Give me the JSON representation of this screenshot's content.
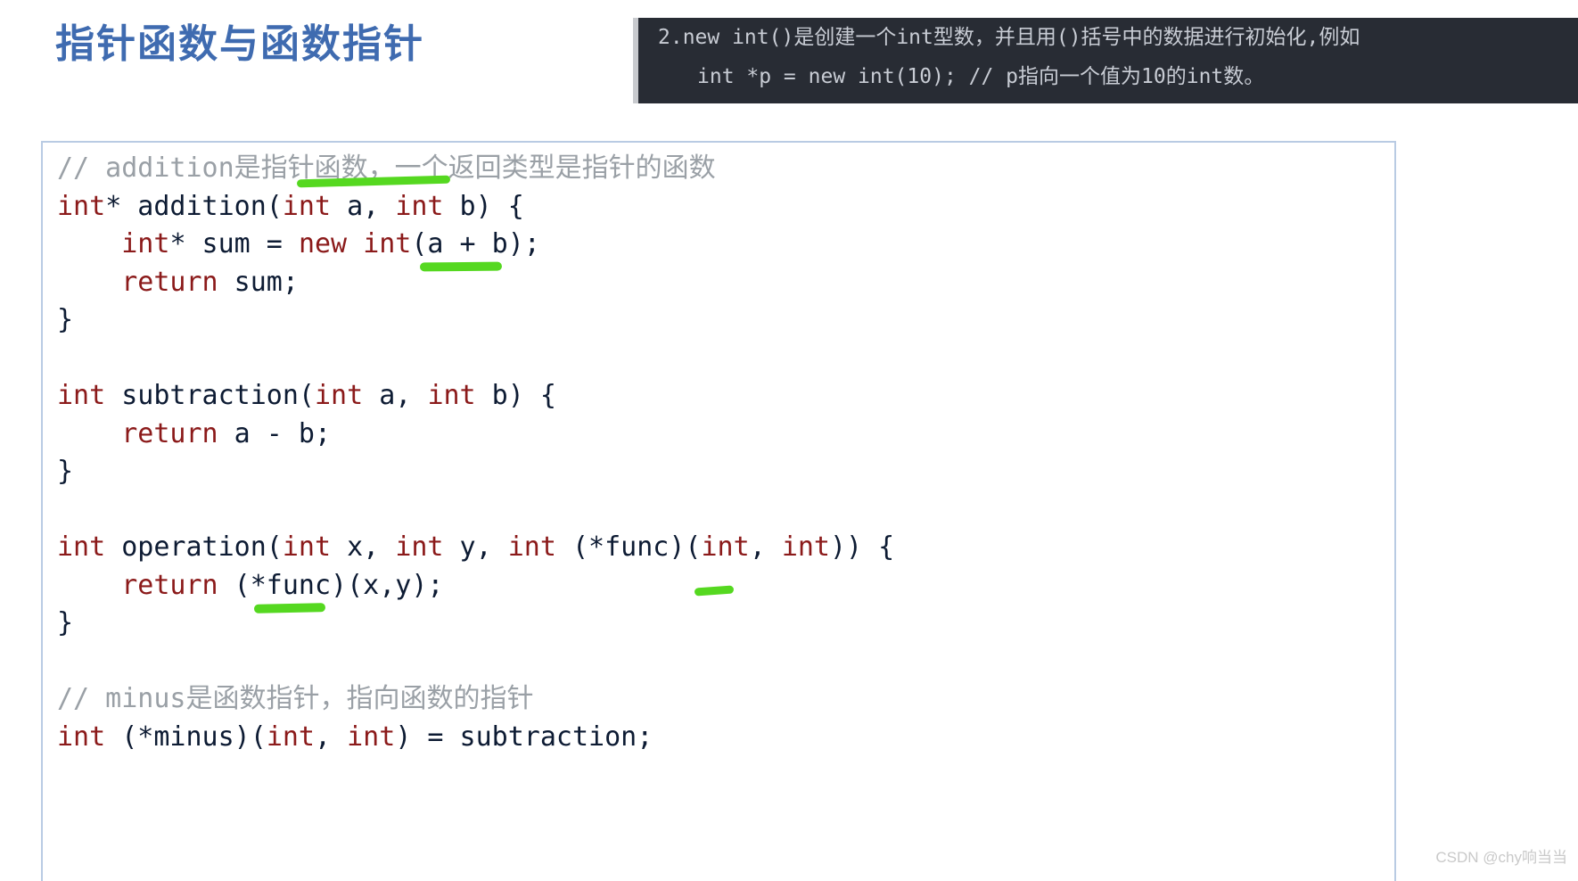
{
  "slide": {
    "title": "指针函数与函数指针",
    "title_color": "#3f6bb0",
    "background_color": "#ffffff"
  },
  "note_box": {
    "background_color": "#282c34",
    "text_color": "#c8ccd4",
    "accent_color": "#c8cace",
    "lines": [
      "2.new int()是创建一个int型数，并且用()括号中的数据进行初始化,例如",
      "int *p = new int(10); // p指向一个值为10的int数。"
    ]
  },
  "code_block": {
    "border_color": "#b9cbe3",
    "background_color": "#ffffff",
    "comment_color": "#9aa0a6",
    "keyword_color": "#8b1a1a",
    "plain_color": "#0d1b33",
    "lines": [
      [
        {
          "t": "// addition是指针函数，一个返回类型是指针的函数",
          "c": "cmt"
        }
      ],
      [
        {
          "t": "int",
          "c": "kw"
        },
        {
          "t": "* addition(",
          "c": "pln"
        },
        {
          "t": "int",
          "c": "kw"
        },
        {
          "t": " a, ",
          "c": "pln"
        },
        {
          "t": "int",
          "c": "kw"
        },
        {
          "t": " b) {",
          "c": "pln"
        }
      ],
      [
        {
          "t": "    ",
          "c": "pln"
        },
        {
          "t": "int",
          "c": "kw"
        },
        {
          "t": "* sum = ",
          "c": "pln"
        },
        {
          "t": "new",
          "c": "kw"
        },
        {
          "t": " ",
          "c": "pln"
        },
        {
          "t": "int",
          "c": "kw"
        },
        {
          "t": "(a + b);",
          "c": "pln"
        }
      ],
      [
        {
          "t": "    ",
          "c": "pln"
        },
        {
          "t": "return",
          "c": "kw"
        },
        {
          "t": " sum;",
          "c": "pln"
        }
      ],
      [
        {
          "t": "}",
          "c": "pln"
        }
      ],
      [
        {
          "t": "",
          "c": "pln"
        }
      ],
      [
        {
          "t": "int",
          "c": "kw"
        },
        {
          "t": " subtraction(",
          "c": "pln"
        },
        {
          "t": "int",
          "c": "kw"
        },
        {
          "t": " a, ",
          "c": "pln"
        },
        {
          "t": "int",
          "c": "kw"
        },
        {
          "t": " b) {",
          "c": "pln"
        }
      ],
      [
        {
          "t": "    ",
          "c": "pln"
        },
        {
          "t": "return",
          "c": "kw"
        },
        {
          "t": " a - b;",
          "c": "pln"
        }
      ],
      [
        {
          "t": "}",
          "c": "pln"
        }
      ],
      [
        {
          "t": "",
          "c": "pln"
        }
      ],
      [
        {
          "t": "int",
          "c": "kw"
        },
        {
          "t": " operation(",
          "c": "pln"
        },
        {
          "t": "int",
          "c": "kw"
        },
        {
          "t": " x, ",
          "c": "pln"
        },
        {
          "t": "int",
          "c": "kw"
        },
        {
          "t": " y, ",
          "c": "pln"
        },
        {
          "t": "int",
          "c": "kw"
        },
        {
          "t": " (*func)(",
          "c": "pln"
        },
        {
          "t": "int",
          "c": "kw"
        },
        {
          "t": ", ",
          "c": "pln"
        },
        {
          "t": "int",
          "c": "kw"
        },
        {
          "t": ")) {",
          "c": "pln"
        }
      ],
      [
        {
          "t": "    ",
          "c": "pln"
        },
        {
          "t": "return",
          "c": "kw"
        },
        {
          "t": " (*func)(x,y);",
          "c": "pln"
        }
      ],
      [
        {
          "t": "}",
          "c": "pln"
        }
      ],
      [
        {
          "t": "",
          "c": "pln"
        }
      ],
      [
        {
          "t": "// minus是函数指针，指向函数的指针",
          "c": "cmt"
        }
      ],
      [
        {
          "t": "int",
          "c": "kw"
        },
        {
          "t": " (*minus)(",
          "c": "pln"
        },
        {
          "t": "int",
          "c": "kw"
        },
        {
          "t": ", ",
          "c": "pln"
        },
        {
          "t": "int",
          "c": "kw"
        },
        {
          "t": ") = subtraction;",
          "c": "pln"
        }
      ]
    ]
  },
  "annotations": {
    "marker_color": "#55d820",
    "strokes": [
      {
        "name": "marker-over-pointer-function-text"
      },
      {
        "name": "marker-under-new-int"
      },
      {
        "name": "marker-under-func-call"
      },
      {
        "name": "marker-near-func-pointer-param"
      }
    ]
  },
  "watermark": {
    "text": "CSDN @chy响当当"
  }
}
